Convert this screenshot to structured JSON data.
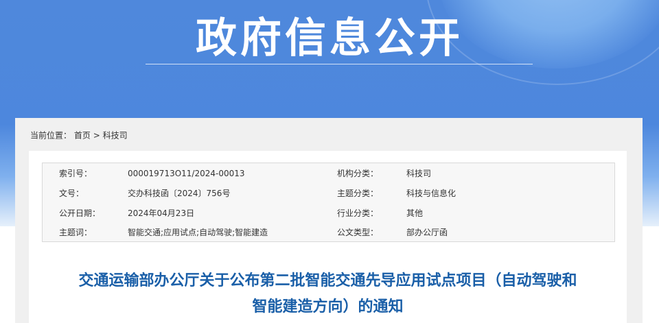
{
  "banner": {
    "title": "政府信息公开"
  },
  "breadcrumb": {
    "label": "当前位置：",
    "items": [
      "首页",
      "科技司"
    ],
    "separator": ">"
  },
  "meta": {
    "left": [
      {
        "label": "索引号：",
        "value": "000019713O11/2024-00013"
      },
      {
        "label": "文号：",
        "value": "交办科技函〔2024〕756号"
      },
      {
        "label": "公开日期：",
        "value": "2024年04月23日"
      },
      {
        "label": "主题词：",
        "value": "智能交通;应用试点;自动驾驶;智能建造"
      }
    ],
    "right": [
      {
        "label": "机构分类：",
        "value": "科技司"
      },
      {
        "label": "主题分类：",
        "value": "科技与信息化"
      },
      {
        "label": "行业分类：",
        "value": "其他"
      },
      {
        "label": "公文类型：",
        "value": "部办公厅函"
      }
    ]
  },
  "document": {
    "title_line1": "交通运输部办公厅关于公布第二批智能交通先导应用试点项目（自动驾驶和",
    "title_line2": "智能建造方向）的通知"
  },
  "colors": {
    "banner": "#4d87dd",
    "title": "#1a5fa8"
  }
}
